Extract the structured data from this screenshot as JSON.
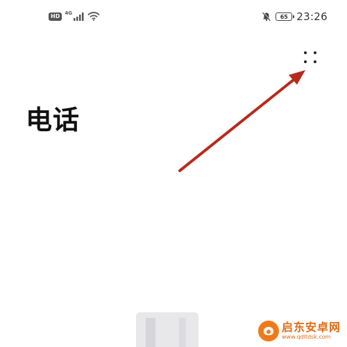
{
  "status_bar": {
    "hd_label": "HD",
    "network_label": "4G",
    "battery_level": "65",
    "time": "23:26",
    "icons": [
      "hd-icon",
      "signal-icon",
      "wifi-icon",
      "bell-muted-icon",
      "battery-icon"
    ]
  },
  "header": {
    "title": "电话",
    "more_menu_icon": "four-dots-icon"
  },
  "annotation": {
    "arrow_color": "#b72a1c"
  },
  "watermark": {
    "name": "启东安卓网",
    "url": "www.qdltdsk.com",
    "brand_color": "#f07a1a"
  }
}
